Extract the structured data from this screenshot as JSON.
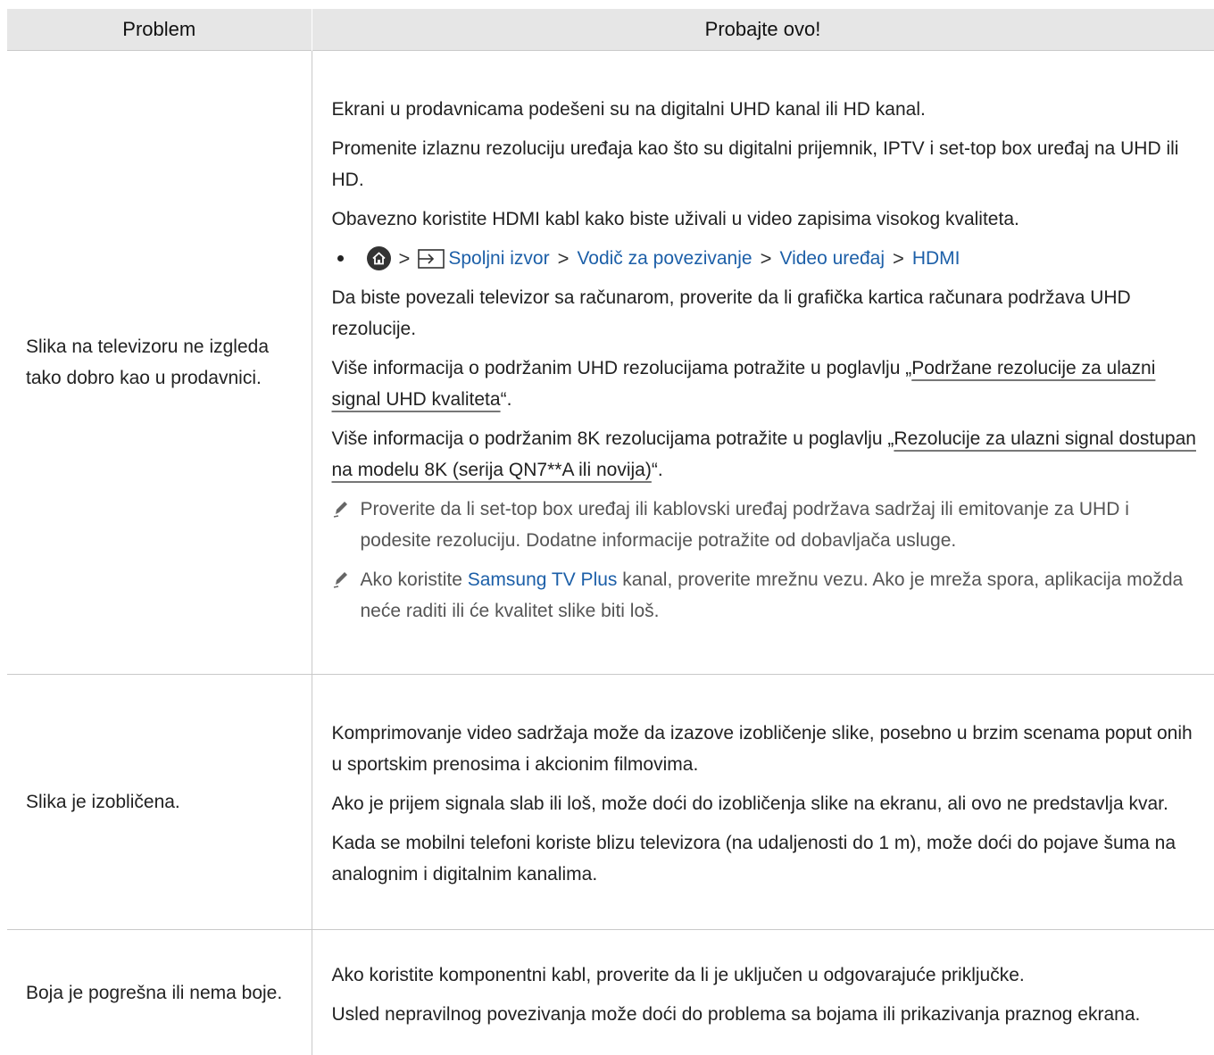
{
  "table": {
    "headers": [
      "Problem",
      "Probajte ovo!"
    ],
    "row1": {
      "problem": "Slika na televizoru ne izgleda tako dobro kao u prodavnici.",
      "p1": "Ekrani u prodavnicama podešeni su na digitalni UHD kanal ili HD kanal.",
      "p2": "Promenite izlaznu rezoluciju uređaja kao što su digitalni prijemnik, IPTV i set-top box uređaj na UHD ili HD.",
      "p3": "Obavezno koristite HDMI kabl kako biste uživali u video zapisima visokog kvaliteta.",
      "path": {
        "home_icon": "home-icon",
        "source_icon": "source-input-icon",
        "items": [
          "Spoljni izvor",
          "Vodič za povezivanje",
          "Video uređaj",
          "HDMI"
        ],
        "separator": ">"
      },
      "p4": "Da biste povezali televizor sa računarom, proverite da li grafička kartica računara podržava UHD rezolucije.",
      "p5_pre": "Više informacija o podržanim UHD rezolucijama potražite u poglavlju „",
      "p5_link": "Podržane rezolucije za ulazni signal UHD kvaliteta",
      "p5_post": "“.",
      "p6_pre": "Više informacija o podržanim 8K rezolucijama potražite u poglavlju „",
      "p6_link": "Rezolucije za ulazni signal dostupan na modelu 8K (serija QN7**A ili novija)",
      "p6_post": "“.",
      "note1": "Proverite da li set-top box uređaj ili kablovski uređaj podržava sadržaj ili emitovanje za UHD i podesite rezoluciju. Dodatne informacije potražite od dobavljača usluge.",
      "note2_pre": "Ako koristite ",
      "note2_link": "Samsung TV Plus",
      "note2_post": " kanal, proverite mrežnu vezu. Ako je mreža spora, aplikacija možda neće raditi ili će kvalitet slike biti loš."
    },
    "row2": {
      "problem": "Slika je izobličena.",
      "p1": "Komprimovanje video sadržaja može da izazove izobličenje slike, posebno u brzim scenama poput onih u sportskim prenosima i akcionim filmovima.",
      "p2": "Ako je prijem signala slab ili loš, može doći do izobličenja slike na ekranu, ali ovo ne predstavlja kvar.",
      "p3": "Kada se mobilni telefoni koriste blizu televizora (na udaljenosti do 1 m), može doći do pojave šuma na analognim i digitalnim kanalima."
    },
    "row3": {
      "problem": "Boja je pogrešna ili nema boje.",
      "p1": "Ako koristite komponentni kabl, proverite da li je uključen u odgovarajuće priključke.",
      "p2": "Usled nepravilnog povezivanja može doći do problema sa bojama ili prikazivanja praznog ekrana."
    }
  }
}
